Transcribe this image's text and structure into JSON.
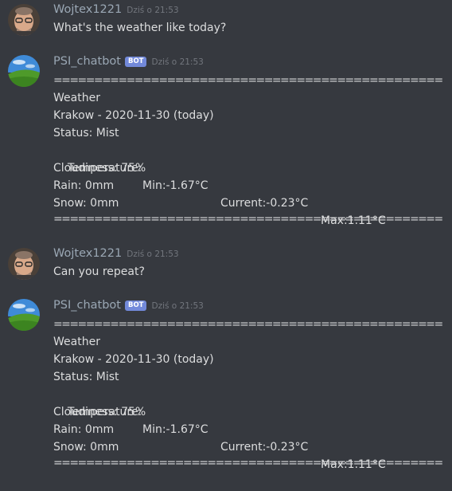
{
  "messages": [
    {
      "user": "Wojtex1221",
      "timestamp": "Dziś o 21:53",
      "text": "What's the weather like today?"
    },
    {
      "user": "PSI_chatbot",
      "bot_tag": "BOT",
      "timestamp": "Dziś o 21:53",
      "separator": "================================================",
      "heading": "Weather",
      "location": "Krakow - 2020-11-30 (today)",
      "status": "Status: Mist",
      "temp_label": "Temperature:",
      "temp_min": "Min:-1.67°C",
      "temp_current": "Current:-0.23°C",
      "temp_max": "Max:1.11°C",
      "cloudiness": "Cloudiness: 75%",
      "rain": "Rain: 0mm",
      "snow": "Snow: 0mm"
    },
    {
      "user": "Wojtex1221",
      "timestamp": "Dziś o 21:53",
      "text": "Can you repeat?"
    },
    {
      "user": "PSI_chatbot",
      "bot_tag": "BOT",
      "timestamp": "Dziś o 21:53",
      "separator": "================================================",
      "heading": "Weather",
      "location": "Krakow - 2020-11-30 (today)",
      "status": "Status: Mist",
      "temp_label": "Temperature:",
      "temp_min": "Min:-1.67°C",
      "temp_current": "Current:-0.23°C",
      "temp_max": "Max:1.11°C",
      "cloudiness": "Cloudiness: 75%",
      "rain": "Rain: 0mm",
      "snow": "Snow: 0mm"
    }
  ],
  "colors": {
    "background": "#36393f",
    "username": "#9aa7b4",
    "text": "#dcddde",
    "timestamp": "#72767d",
    "bot_tag": "#7289da"
  }
}
